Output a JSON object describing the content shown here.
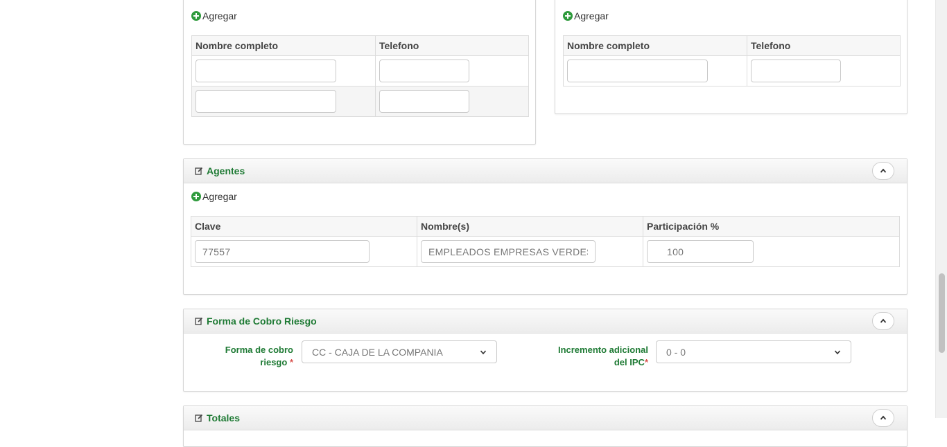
{
  "contacts_left": {
    "add_label": "Agregar",
    "columns": [
      "Nombre completo",
      "Telefono"
    ],
    "rows": [
      {
        "nombre": "",
        "telefono": ""
      },
      {
        "nombre": "",
        "telefono": ""
      }
    ]
  },
  "contacts_right": {
    "add_label": "Agregar",
    "columns": [
      "Nombre completo",
      "Telefono"
    ],
    "rows": [
      {
        "nombre": "",
        "telefono": ""
      }
    ]
  },
  "agentes": {
    "title": "Agentes",
    "add_label": "Agregar",
    "columns": [
      "Clave",
      "Nombre(s)",
      "Participación %"
    ],
    "rows": [
      {
        "clave": "77557",
        "nombre": "EMPLEADOS EMPRESAS VERDES",
        "participacion": "100"
      }
    ]
  },
  "forma_cobro": {
    "title": "Forma de Cobro Riesgo",
    "forma_label_line1": "Forma de cobro",
    "forma_label_line2": "riesgo",
    "required_mark": "*",
    "forma_value": "CC - CAJA DE LA COMPANIA",
    "incremento_label_line1": "Incremento adicional",
    "incremento_label_line2": "del IPC",
    "incremento_value": "0 - 0"
  },
  "totales": {
    "title": "Totales"
  },
  "colors": {
    "accent_green": "#1e7a34",
    "add_icon_green": "#2e9a3c",
    "required_red": "#d9534f"
  },
  "icons": [
    "plus-circle-icon",
    "edit-icon",
    "chevron-up-icon",
    "chevron-down-icon"
  ]
}
